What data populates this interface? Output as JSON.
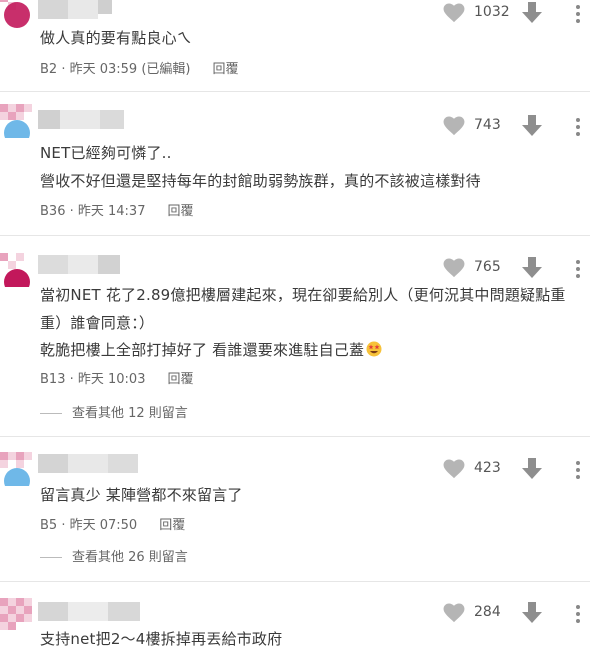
{
  "comments": [
    {
      "lines": [
        "做人真的要有點良心ㄟ"
      ],
      "floor": "B2",
      "date": "昨天 03:59 (已編輯)",
      "reply_label": "回覆",
      "likes": "1032"
    },
    {
      "lines": [
        "NET已經夠可憐了..",
        "營收不好但還是堅持每年的封館助弱勢族群，真的不該被這樣對待"
      ],
      "floor": "B36",
      "date": "昨天 14:37",
      "reply_label": "回覆",
      "likes": "743"
    },
    {
      "lines": [
        "當初NET 花了2.89億把樓層建起來，現在卻要給別人（更何況其中問題疑點重",
        "重）誰會同意：）",
        "乾脆把樓上全部打掉好了 看誰還要來進駐自己蓋"
      ],
      "floor": "B13",
      "date": "昨天 10:03",
      "reply_label": "回覆",
      "likes": "765",
      "more_replies": "查看其他 12 則留言",
      "emoji": "star-struck-emoji"
    },
    {
      "lines": [
        "留言真少 某陣營都不來留言了"
      ],
      "floor": "B5",
      "date": "昨天 07:50",
      "reply_label": "回覆",
      "likes": "423",
      "more_replies": "查看其他 26 則留言"
    },
    {
      "lines": [
        "支持net把2～4樓拆掉再丟給市政府"
      ],
      "likes": "284"
    }
  ],
  "colors": {
    "heart": "#b5b5b5",
    "arrow": "#8e8e8e",
    "text": "#3a3a3a",
    "meta": "#666666",
    "avatar_pink": "#e8a3bd",
    "avatar_blue": "#6fb8e8",
    "blur_gray": "#d8d8d8"
  },
  "icons": [
    "heart-icon",
    "downvote-icon",
    "more-options-icon",
    "star-struck-emoji"
  ]
}
